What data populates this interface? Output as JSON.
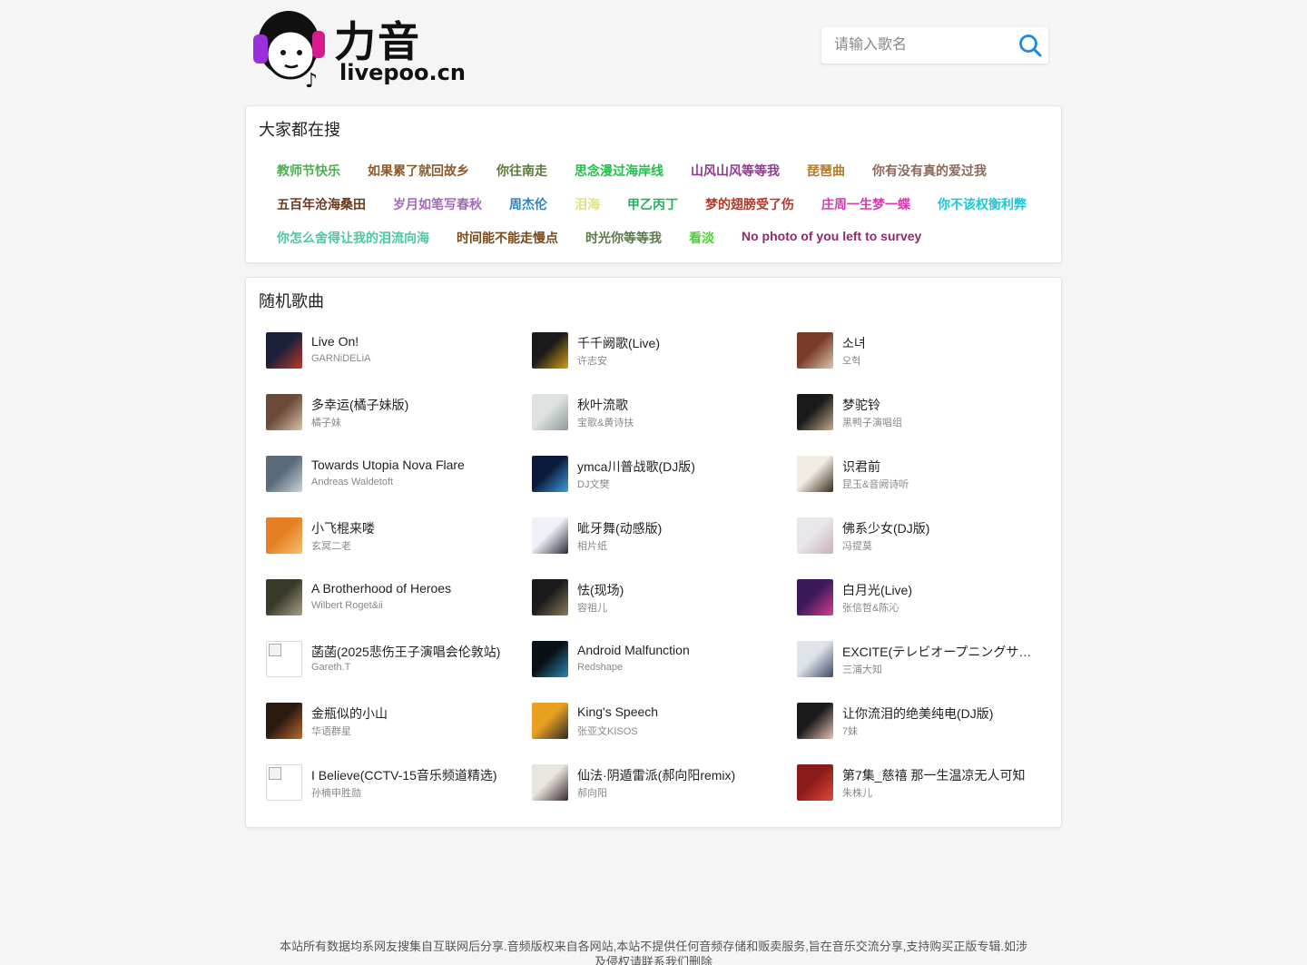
{
  "brand": {
    "name": "力音",
    "domain": "livepoo.cn"
  },
  "search": {
    "placeholder": "请输入歌名",
    "icon": "search-icon",
    "icon_color": "#1e88e5"
  },
  "hot_searches": {
    "title": "大家都在搜",
    "rows": [
      [
        {
          "text": "教师节快乐",
          "color": "#4caf50"
        },
        {
          "text": "如果累了就回故乡",
          "color": "#8d5a2b"
        },
        {
          "text": "你往南走",
          "color": "#5b7b3a"
        },
        {
          "text": "思念漫过海岸线",
          "color": "#22c04a"
        },
        {
          "text": "山风山风等等我",
          "color": "#8e3a8e"
        },
        {
          "text": "琵琶曲",
          "color": "#b07a2a"
        },
        {
          "text": "你有没有真的爱过我",
          "color": "#8a6a5a"
        }
      ],
      [
        {
          "text": "五百年沧海桑田",
          "color": "#6b3a1a"
        },
        {
          "text": "岁月如笔写春秋",
          "color": "#a569bd"
        },
        {
          "text": "周杰伦",
          "color": "#2e86c1"
        },
        {
          "text": "泪海",
          "color": "#e3e08a"
        },
        {
          "text": "甲乙丙丁",
          "color": "#27ae60"
        },
        {
          "text": "梦的翅膀受了伤",
          "color": "#b03a2e"
        },
        {
          "text": "庄周一生梦一蝶",
          "color": "#d63ab0"
        },
        {
          "text": "你不该权衡利弊",
          "color": "#1ec7d6"
        }
      ],
      [
        {
          "text": "你怎么舍得让我的泪流向海",
          "color": "#48c9a0"
        },
        {
          "text": "时间能不能走慢点",
          "color": "#7a4a1a"
        },
        {
          "text": "时光你等等我",
          "color": "#5a7a4a"
        },
        {
          "text": "看淡",
          "color": "#4cd137"
        },
        {
          "text": "No photo of you left to survey",
          "color": "#8e2b6b"
        }
      ]
    ]
  },
  "random_songs": {
    "title": "随机歌曲",
    "columns": [
      [
        {
          "title": "Live On!",
          "artist": "GARNiDELiA",
          "cover": [
            "#1a1f3a",
            "#c0392b"
          ]
        },
        {
          "title": "多幸运(橘子妹版)",
          "artist": "橘子妹",
          "cover": [
            "#6b4a3a",
            "#d9c2a8"
          ]
        },
        {
          "title": "Towards Utopia Nova Flare",
          "artist": "Andreas Waldetoft",
          "cover": [
            "#5a6a7a",
            "#c8d4dc"
          ]
        },
        {
          "title": "小飞棍来喽",
          "artist": "玄冥二老",
          "cover": [
            "#e67e22",
            "#f5c06a"
          ]
        },
        {
          "title": "A Brotherhood of Heroes",
          "artist": "Wilbert Roget&ii",
          "cover": [
            "#3a3a2a",
            "#a8a08a"
          ]
        },
        {
          "title": "菡菡(2025悲伤王子演唱会伦敦站)",
          "artist": "Gareth.T",
          "cover": "broken"
        },
        {
          "title": "金瓶似的小山",
          "artist": "华语群星",
          "cover": [
            "#2a1a10",
            "#b56a2a"
          ]
        },
        {
          "title": "I Believe(CCTV-15音乐频道精选)",
          "artist": "孙楠申胜勋",
          "cover": "broken"
        }
      ],
      [
        {
          "title": "千千阙歌(Live)",
          "artist": "许志安",
          "cover": [
            "#1a1a1a",
            "#d4a017"
          ]
        },
        {
          "title": "秋叶流歌",
          "artist": "宝歌&黄诗扶",
          "cover": [
            "#dfe3e0",
            "#8a9a9a"
          ]
        },
        {
          "title": "ymca川普战歌(DJ版)",
          "artist": "DJ文樊",
          "cover": [
            "#0a1a3a",
            "#3aa0e0"
          ]
        },
        {
          "title": "呲牙舞(动感版)",
          "artist": "相片纸",
          "cover": [
            "#eef2f6",
            "#2a2a3a"
          ]
        },
        {
          "title": "怯(现场)",
          "artist": "容祖儿",
          "cover": [
            "#1a1a1a",
            "#8a7a5a"
          ]
        },
        {
          "title": "Android Malfunction",
          "artist": "Redshape",
          "cover": [
            "#0a1018",
            "#2a8ab0"
          ]
        },
        {
          "title": "King's Speech",
          "artist": "张亚文KISOS",
          "cover": [
            "#e8a020",
            "#2a2a2a"
          ]
        },
        {
          "title": "仙法·阴遁雷派(郝向阳remix)",
          "artist": "郝向阳",
          "cover": [
            "#e8e4e0",
            "#3a2a2a"
          ]
        }
      ],
      [
        {
          "title": "소녀",
          "artist": "오혁",
          "cover": [
            "#7a3a2a",
            "#d8c8a8"
          ]
        },
        {
          "title": "梦驼铃",
          "artist": "黑鸭子演唱组",
          "cover": [
            "#1a1a1a",
            "#c8a888"
          ]
        },
        {
          "title": "识君前",
          "artist": "昆玉&音阙诗听",
          "cover": [
            "#f2ede4",
            "#3a2a1a"
          ]
        },
        {
          "title": "佛系少女(DJ版)",
          "artist": "冯提莫",
          "cover": [
            "#e8e8ec",
            "#c8b0b8"
          ]
        },
        {
          "title": "白月光(Live)",
          "artist": "张信哲&陈沁",
          "cover": [
            "#3a1a5a",
            "#e03a8a"
          ]
        },
        {
          "title": "EXCITE(テレビオープニングサイズ)",
          "artist": "三浦大知",
          "cover": [
            "#dfe3ea",
            "#3a4a6a"
          ]
        },
        {
          "title": "让你流泪的绝美纯电(DJ版)",
          "artist": "7妹",
          "cover": [
            "#1a1a1a",
            "#e8c0b0"
          ]
        },
        {
          "title": "第7集_慈禧 那一生温凉无人可知",
          "artist": "朱株儿",
          "cover": [
            "#8a1a1a",
            "#e04a3a"
          ]
        }
      ]
    ]
  },
  "footer": {
    "line1": "本站所有数据均系网友搜集自互联网后分享.音频版权来自各网站,本站不提供任何音频存储和贩卖服务,旨在音乐交流分享,支持购买正版专辑.如涉",
    "line2": "及侵权请联系我们删除"
  }
}
